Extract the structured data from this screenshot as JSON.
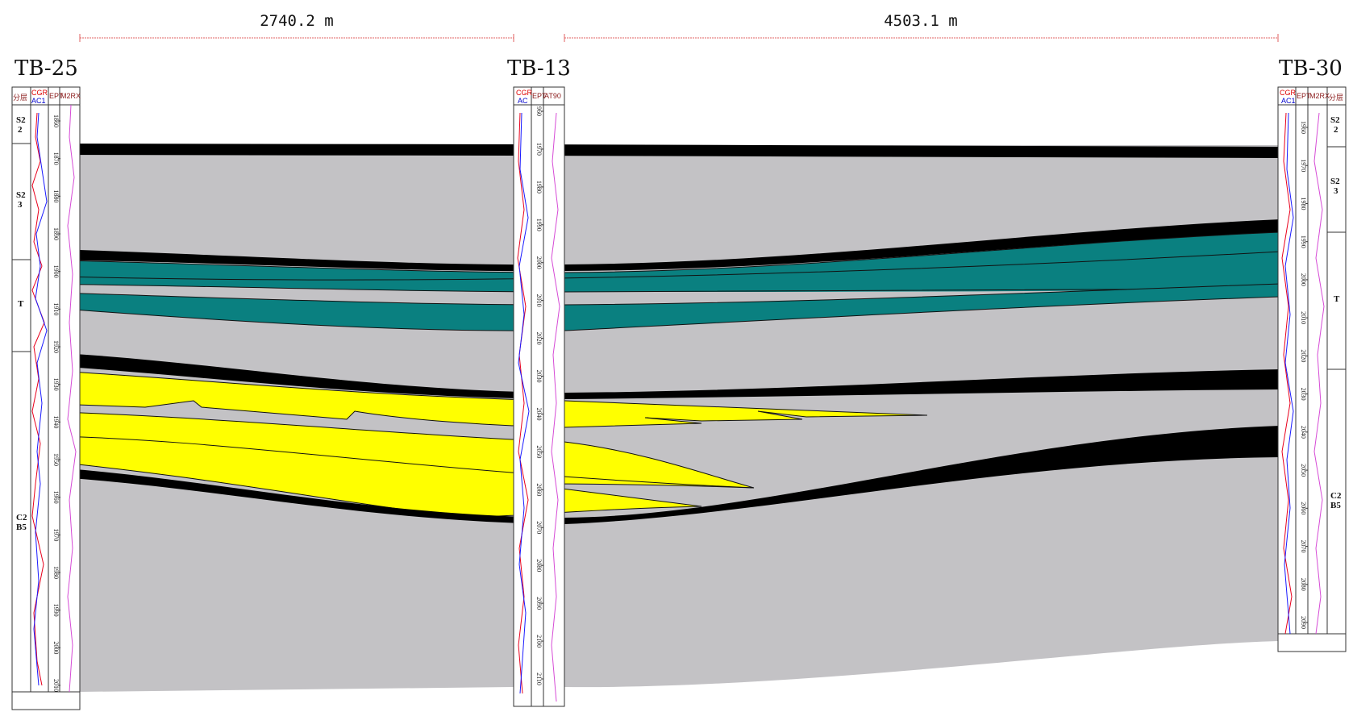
{
  "distances": [
    {
      "label": "2740.2 m"
    },
    {
      "label": "4503.1 m"
    }
  ],
  "wells": [
    {
      "name": "TB-25",
      "headers": [
        "分层",
        "CGR",
        "AC1",
        "EPT",
        "M2RX"
      ],
      "zones": [
        "S2\n2",
        "S2\n3",
        "T",
        "C2\nB5"
      ],
      "depths": [
        "1860",
        "1870",
        "1880",
        "1890",
        "1900",
        "1910",
        "1920",
        "1930",
        "1940",
        "1950",
        "1960",
        "1970",
        "1980",
        "1990",
        "2000",
        "2010"
      ]
    },
    {
      "name": "TB-13",
      "headers": [
        "CGR",
        "AC",
        "EPT",
        "AT90"
      ],
      "zones": [],
      "depths": [
        "960",
        "1970",
        "1980",
        "1990",
        "2000",
        "2010",
        "2020",
        "2030",
        "2040",
        "2050",
        "2060",
        "2070",
        "2080",
        "2090",
        "2100",
        "2110"
      ]
    },
    {
      "name": "TB-30",
      "headers": [
        "CGR",
        "AC1",
        "EPT",
        "M2RX",
        "分层"
      ],
      "zones": [
        "S2\n2",
        "S2\n3",
        "T",
        "C2\nB5"
      ],
      "depths": [
        "1960",
        "1970",
        "1980",
        "1990",
        "2000",
        "2010",
        "2020",
        "2030",
        "2040",
        "2050",
        "2060",
        "2070",
        "2080",
        "2090"
      ]
    }
  ],
  "colors": {
    "background_fill": "#c3c2c5",
    "shale": "#000000",
    "teal_sand": "#0a8080",
    "yellow_sand": "#ffff00",
    "curve_red": "#e8001c",
    "curve_blue": "#1a1aff",
    "curve_magenta": "#d64bd6",
    "ruler": "#e06060"
  }
}
